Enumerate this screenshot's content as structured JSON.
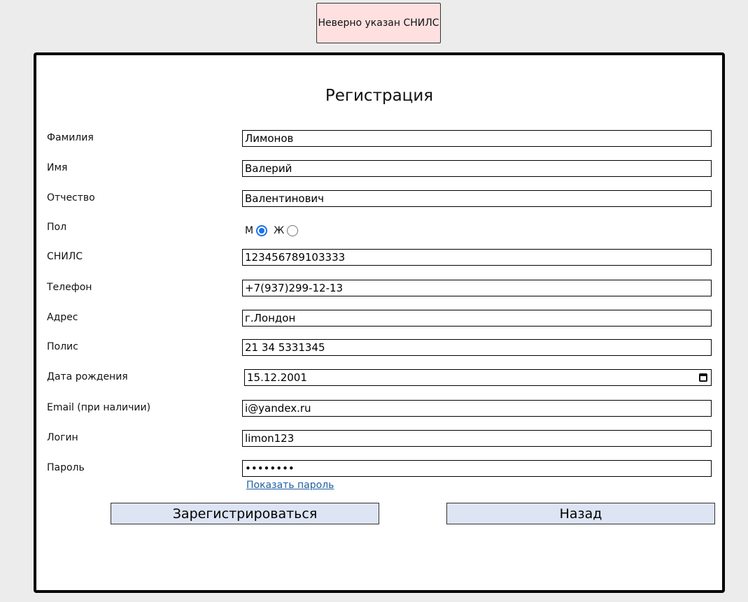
{
  "error": {
    "message": "Неверно указан СНИЛС",
    "bg_color": "#ffe0e0"
  },
  "form": {
    "title": "Регистрация",
    "fields": {
      "surname": {
        "label": "Фамилия",
        "value": "Лимонов"
      },
      "name": {
        "label": "Имя",
        "value": "Валерий"
      },
      "patronymic": {
        "label": "Отчество",
        "value": "Валентинович"
      },
      "gender": {
        "label": "Пол",
        "options": [
          {
            "label": "М",
            "checked": true
          },
          {
            "label": "Ж",
            "checked": false
          }
        ]
      },
      "snils": {
        "label": "СНИЛС",
        "value": "123456789103333"
      },
      "phone": {
        "label": "Телефон",
        "value": "+7(937)299-12-13"
      },
      "address": {
        "label": "Адрес",
        "value": "г.Лондон"
      },
      "policy": {
        "label": "Полис",
        "value": "21 34 5331345"
      },
      "birthdate": {
        "label": "Дата рождения",
        "value": "15.12.2001",
        "icon": "calendar-icon"
      },
      "email": {
        "label": "Email (при наличии)",
        "value": "i@yandex.ru"
      },
      "login": {
        "label": "Логин",
        "value": "limon123"
      },
      "password": {
        "label": "Пароль",
        "value": "••••••••"
      }
    },
    "show_password_label": "Показать пароль",
    "register_label": "Зарегистрироваться",
    "back_label": "Назад"
  },
  "colors": {
    "accent": "#1a73e8",
    "button_bg": "#dde4f4",
    "link": "#1f5fa0",
    "page_bg": "#ececec"
  }
}
